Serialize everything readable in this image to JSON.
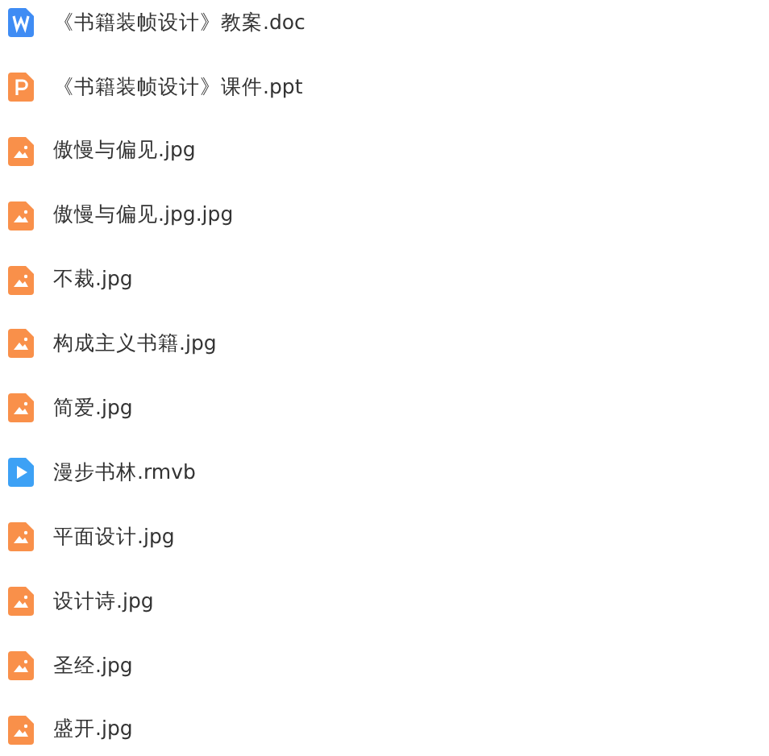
{
  "files": [
    {
      "name": "《书籍装帧设计》教案.doc",
      "kind": "doc"
    },
    {
      "name": "《书籍装帧设计》课件.ppt",
      "kind": "ppt"
    },
    {
      "name": "傲慢与偏见.jpg",
      "kind": "image"
    },
    {
      "name": "傲慢与偏见.jpg.jpg",
      "kind": "image"
    },
    {
      "name": "不裁.jpg",
      "kind": "image"
    },
    {
      "name": "构成主义书籍.jpg",
      "kind": "image"
    },
    {
      "name": "简爱.jpg",
      "kind": "image"
    },
    {
      "name": "漫步书林.rmvb",
      "kind": "video"
    },
    {
      "name": "平面设计.jpg",
      "kind": "image"
    },
    {
      "name": "设计诗.jpg",
      "kind": "image"
    },
    {
      "name": "圣经.jpg",
      "kind": "image"
    },
    {
      "name": "盛开.jpg",
      "kind": "image"
    }
  ]
}
